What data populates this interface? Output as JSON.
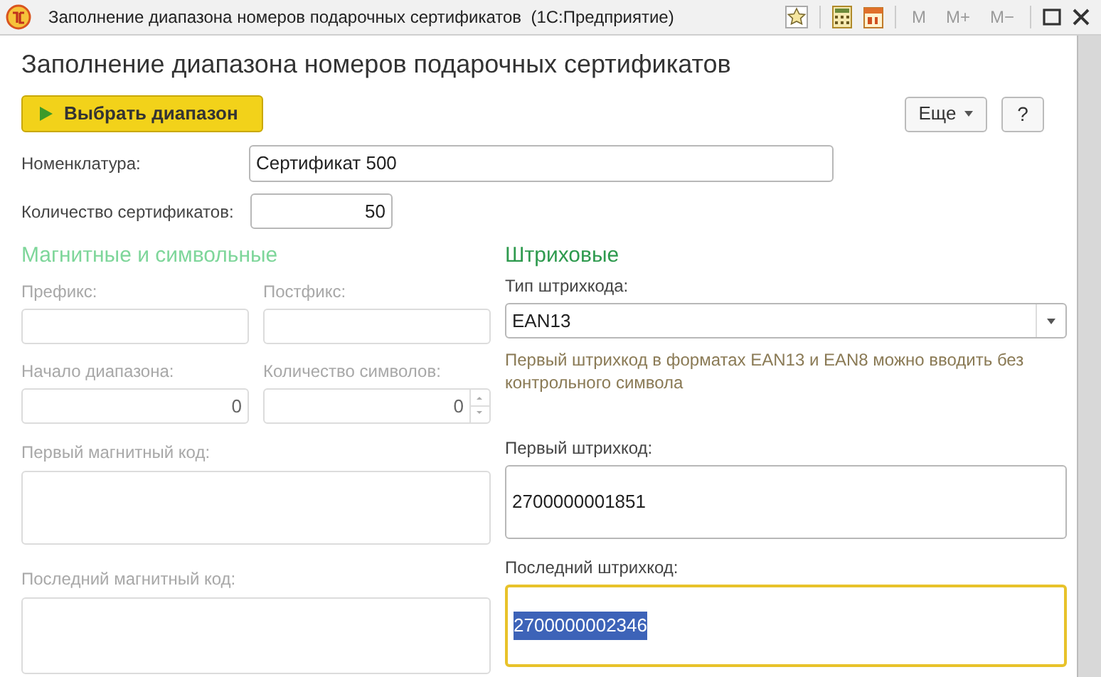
{
  "window": {
    "title": "Заполнение диапазона номеров подарочных сертификатов  (1С:Предприятие)",
    "memory_buttons": [
      {
        "label": "M",
        "disabled": true
      },
      {
        "label": "M+",
        "disabled": true
      },
      {
        "label": "M−",
        "disabled": true
      }
    ]
  },
  "heading": "Заполнение диапазона номеров подарочных сертификатов",
  "toolbar": {
    "primary_button": "Выбрать диапазон",
    "more_button": "Еще",
    "help_button": "?"
  },
  "nomenclature": {
    "label": "Номенклатура:",
    "value": "Сертификат 500"
  },
  "count": {
    "label": "Количество сертификатов:",
    "value": "50"
  },
  "magnetic": {
    "title": "Магнитные и символьные",
    "disabled": true,
    "prefix": {
      "label": "Префикс:"
    },
    "postfix": {
      "label": "Постфикс:"
    },
    "range_start": {
      "label": "Начало диапазона:",
      "value": "0"
    },
    "symbol_count": {
      "label": "Количество символов:",
      "value": "0"
    },
    "first_code": {
      "label": "Первый магнитный код:"
    },
    "last_code": {
      "label": "Последний магнитный код:"
    }
  },
  "barcode": {
    "title": "Штриховые",
    "type": {
      "label": "Тип штрихкода:",
      "value": "EAN13"
    },
    "hint": "Первый штрихкод в форматах EAN13 и EAN8 можно вводить без контрольного символа",
    "first": {
      "label": "Первый штрихкод:",
      "value": "2700000001851",
      "focused": false,
      "text_selected": false
    },
    "last": {
      "label": "Последний штрихкод:",
      "value": "2700000002346",
      "focused": true,
      "text_selected": true
    }
  }
}
